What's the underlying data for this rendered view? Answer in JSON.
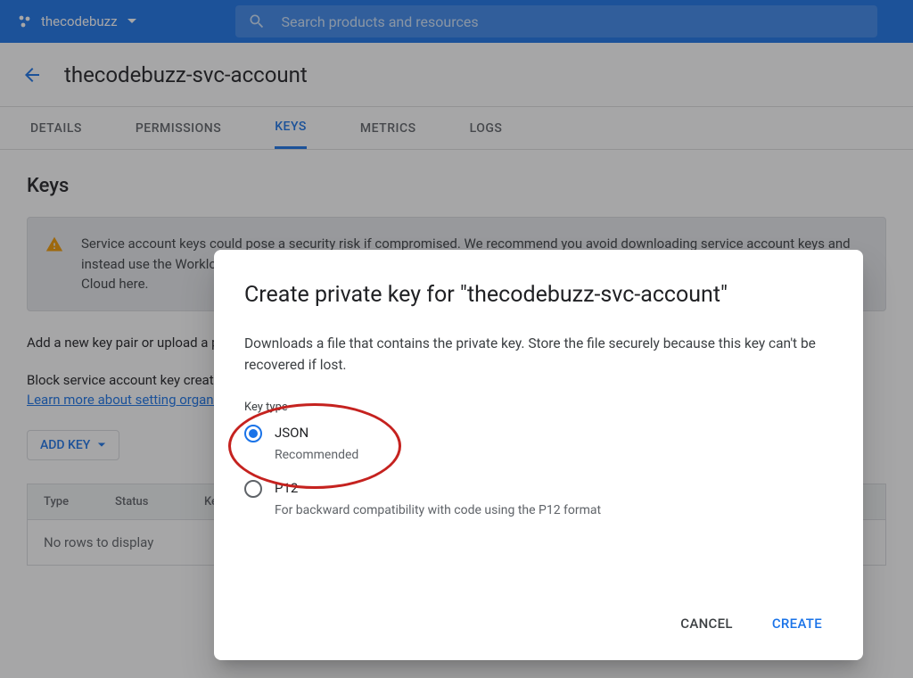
{
  "topbar": {
    "project_name": "thecodebuzz",
    "search_placeholder": "Search products and resources"
  },
  "title_row": {
    "page_title": "thecodebuzz-svc-account"
  },
  "tabs": [
    "DETAILS",
    "PERMISSIONS",
    "KEYS",
    "METRICS",
    "LOGS"
  ],
  "active_tab": "KEYS",
  "keys_section": {
    "heading": "Keys",
    "warning_text": "Service account keys could pose a security risk if compromised. We recommend you avoid downloading service account keys and instead use the Workload Identity Federation. You can learn more about the best way to authenticate service accounts on Google Cloud here.",
    "para1": "Add a new key pair or upload a public key certificate from an existing key pair.",
    "para2_prefix": "Block service account key creation using organization policies.",
    "para2_link": "Learn more about setting organization policies for service accounts",
    "add_key_label": "ADD KEY",
    "table": {
      "columns": [
        "Type",
        "Status",
        "Key"
      ],
      "empty_message": "No rows to display"
    }
  },
  "modal": {
    "title": "Create private key for \"thecodebuzz-svc-account\"",
    "description": "Downloads a file that contains the private key. Store the file securely because this key can't be recovered if lost.",
    "keytype_label": "Key type",
    "options": [
      {
        "label": "JSON",
        "sub": "Recommended",
        "selected": true
      },
      {
        "label": "P12",
        "sub": "For backward compatibility with code using the P12 format",
        "selected": false
      }
    ],
    "cancel_label": "CANCEL",
    "create_label": "CREATE"
  }
}
